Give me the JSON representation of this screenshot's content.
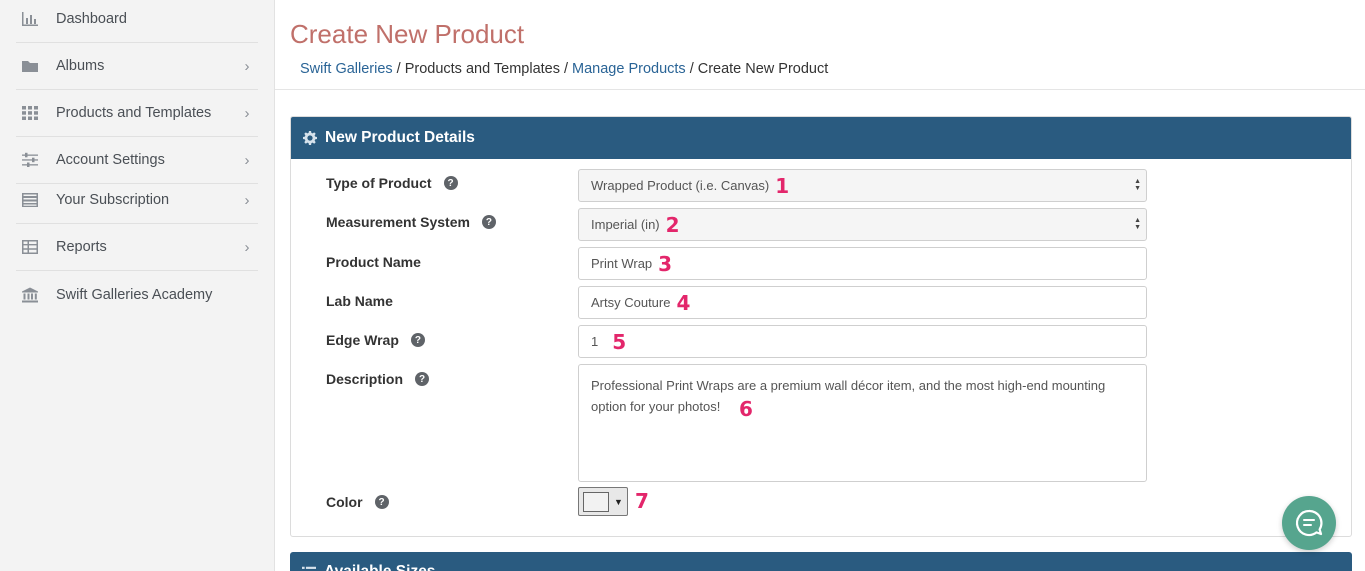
{
  "sidebar": {
    "items": [
      {
        "label": "Dashboard",
        "icon": "bar-chart-icon",
        "chevron": ""
      },
      {
        "label": "Albums",
        "icon": "folder-icon",
        "chevron": "›"
      },
      {
        "label": "Products and Templates",
        "icon": "grid-icon",
        "chevron": "›"
      },
      {
        "label": "Account Settings",
        "icon": "sliders-icon",
        "chevron": "›"
      },
      {
        "label": "Your Subscription",
        "icon": "list-icon",
        "chevron": "›"
      },
      {
        "label": "Reports",
        "icon": "table-icon",
        "chevron": "›"
      },
      {
        "label": "Swift Galleries Academy",
        "icon": "bank-icon",
        "chevron": ""
      }
    ]
  },
  "page": {
    "title": "Create New Product",
    "breadcrumb": {
      "home": "Swift Galleries",
      "section": "Products and Templates",
      "manage": "Manage Products",
      "current": "Create New Product",
      "separator": "/"
    }
  },
  "panel": {
    "title": "New Product Details",
    "help_glyph": "?",
    "fields": {
      "type_label": "Type of Product",
      "type_value": "Wrapped Product (i.e. Canvas)",
      "type_marker": "1",
      "measure_label": "Measurement System",
      "measure_value": "Imperial (in)",
      "measure_marker": "2",
      "name_label": "Product Name",
      "name_value": "Print Wrap",
      "name_marker": "3",
      "lab_label": "Lab Name",
      "lab_value": "Artsy Couture",
      "lab_marker": "4",
      "edge_label": "Edge Wrap",
      "edge_value": "1",
      "edge_marker": "5",
      "desc_label": "Description",
      "desc_value": "Professional Print Wraps are a premium wall décor item, and the most high-end mounting option for your photos!",
      "desc_marker": "6",
      "color_label": "Color",
      "color_marker": "7",
      "color_value": "#f2f2f2"
    }
  },
  "panel2": {
    "title": "Available Sizes"
  },
  "colors": {
    "accent": "#2a5b80",
    "title": "#c0706a",
    "link": "#2a6496",
    "marker": "#e3266b",
    "chat": "#56a58e"
  }
}
